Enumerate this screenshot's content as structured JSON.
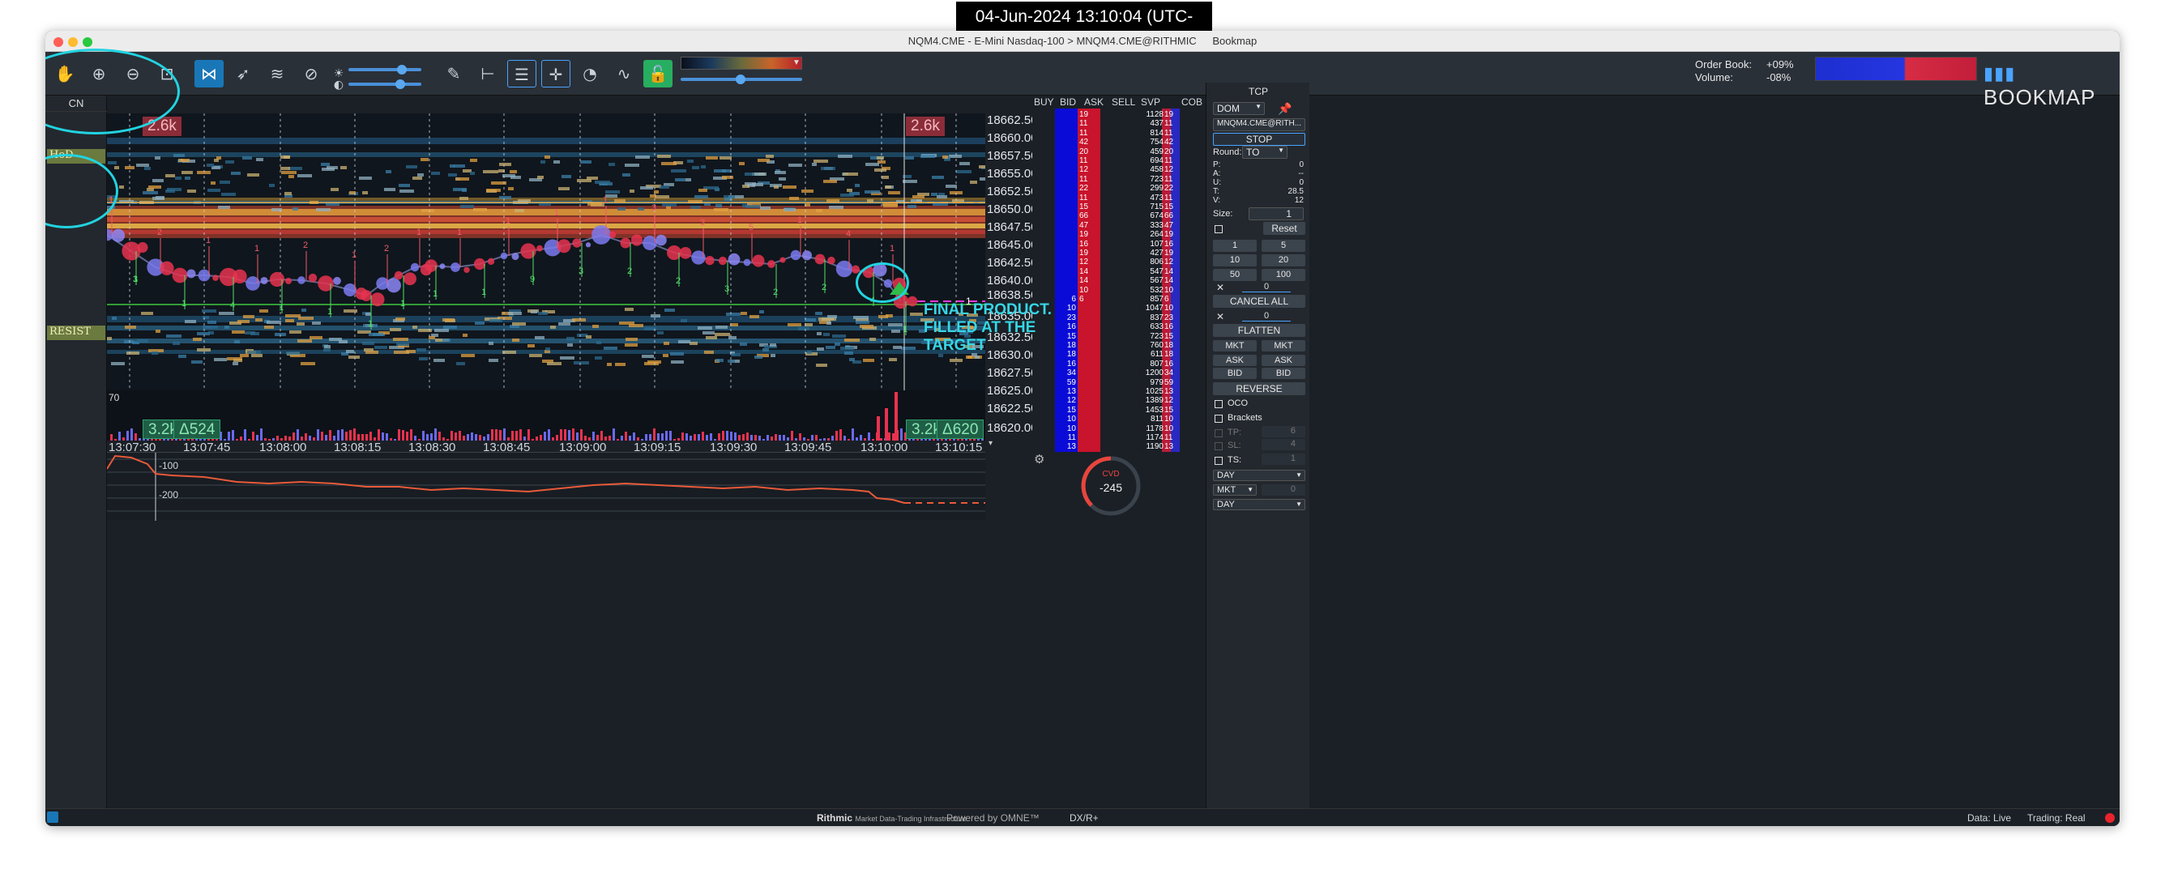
{
  "timestamp": "04-Jun-2024 13:10:04 (UTC-05:00)",
  "window": {
    "title": "NQM4.CME - E-Mini Nasdaq-100 > MNQM4.CME@RITHMIC",
    "app": "Bookmap"
  },
  "toolbar": {
    "icons": [
      "hand-icon",
      "zoom-in-icon",
      "zoom-out-icon",
      "zoom-fit-icon",
      "share-icon",
      "rocket-icon",
      "layers-icon",
      "link-icon",
      "brightness-icon",
      "contrast-icon",
      "pencil-icon",
      "measure-icon",
      "chat-icon",
      "crosshair-icon",
      "stopwatch-icon",
      "indicator-icon",
      "lock-open-icon"
    ]
  },
  "header_info": {
    "order_book_label": "Order Book:",
    "volume_label": "Volume:",
    "order_book_value": "+09%",
    "volume_value": "-08%",
    "logo": "BOOKMAP"
  },
  "sidebar": {
    "header": "CN",
    "labels": [
      "HoD",
      "RESIST"
    ]
  },
  "chart": {
    "top_left_tag": "2.6k",
    "top_right_tag": "2.6k",
    "vol_left": "3.2k",
    "delta_left": "Δ524",
    "vol_right": "3.2k",
    "delta_right": "Δ620",
    "vol_scale": "70",
    "annotation": "FINAL PRODUCT.  FILLED AT THE TARGET",
    "trade_numbers": [
      "1",
      "3",
      "2",
      "1",
      "1",
      "4",
      "1",
      "1",
      "2",
      "1",
      "1",
      "1",
      "2",
      "1",
      "1",
      "1",
      "1",
      "1",
      "1",
      "9",
      "1",
      "3",
      "1",
      "2",
      "3",
      "2",
      "3",
      "3",
      "5",
      "2",
      "1",
      "2",
      "4",
      "4",
      "1",
      "1",
      "1",
      "1"
    ],
    "time_ticks": [
      "13:07:30",
      "13:07:45",
      "13:08:00",
      "13:08:15",
      "13:08:30",
      "13:08:45",
      "13:09:00",
      "13:09:15",
      "13:09:30",
      "13:09:45",
      "13:10:00",
      "13:10:15"
    ],
    "price_ticks": [
      "18662.50",
      "18660.00",
      "18657.50",
      "18655.00",
      "18652.50",
      "18650.00",
      "18647.50",
      "18645.00",
      "18642.50",
      "18640.00",
      "18638.50",
      "18635.00",
      "18632.50",
      "18630.00",
      "18627.50",
      "18625.00",
      "18622.50",
      "18620.00"
    ],
    "order_marker": "1"
  },
  "cvd": {
    "levels": [
      "-100",
      "-200"
    ],
    "gauge_label": "CVD",
    "gauge_value": "-245"
  },
  "ladder": {
    "headers": [
      "BUY",
      "BID",
      "ASK",
      "SELL",
      "SVP",
      "COB"
    ],
    "rows": [
      {
        "ask": "19",
        "svp": "1128",
        "cob": "19"
      },
      {
        "ask": "11",
        "svp": "437",
        "cob": "11"
      },
      {
        "ask": "11",
        "svp": "814",
        "cob": "11"
      },
      {
        "ask": "42",
        "svp": "754",
        "cob": "42"
      },
      {
        "ask": "20",
        "svp": "459",
        "cob": "20"
      },
      {
        "ask": "11",
        "svp": "694",
        "cob": "11"
      },
      {
        "ask": "12",
        "svp": "458",
        "cob": "12"
      },
      {
        "ask": "11",
        "svp": "723",
        "cob": "11"
      },
      {
        "ask": "22",
        "svp": "299",
        "cob": "22"
      },
      {
        "ask": "11",
        "svp": "473",
        "cob": "11"
      },
      {
        "ask": "15",
        "svp": "715",
        "cob": "15"
      },
      {
        "ask": "66",
        "svp": "674",
        "cob": "66"
      },
      {
        "ask": "47",
        "svp": "333",
        "cob": "47"
      },
      {
        "ask": "19",
        "svp": "264",
        "cob": "19"
      },
      {
        "ask": "16",
        "svp": "107",
        "cob": "16"
      },
      {
        "ask": "19",
        "svp": "427",
        "cob": "19"
      },
      {
        "ask": "12",
        "svp": "806",
        "cob": "12"
      },
      {
        "ask": "14",
        "svp": "547",
        "cob": "14"
      },
      {
        "ask": "14",
        "svp": "567",
        "cob": "14"
      },
      {
        "ask": "10",
        "svp": "532",
        "cob": "10"
      },
      {
        "bid": "6",
        "ask": "6",
        "svp": "857",
        "cob": "6"
      },
      {
        "bid": "10",
        "svp": "1047",
        "cob": "10"
      },
      {
        "bid": "23",
        "svp": "837",
        "cob": "23"
      },
      {
        "bid": "16",
        "svp": "633",
        "cob": "16"
      },
      {
        "bid": "15",
        "svp": "723",
        "cob": "15"
      },
      {
        "bid": "18",
        "svp": "760",
        "cob": "18"
      },
      {
        "bid": "18",
        "svp": "611",
        "cob": "18"
      },
      {
        "bid": "16",
        "svp": "807",
        "cob": "16"
      },
      {
        "bid": "34",
        "svp": "1200",
        "cob": "34"
      },
      {
        "bid": "59",
        "svp": "979",
        "cob": "59"
      },
      {
        "bid": "13",
        "svp": "1025",
        "cob": "13"
      },
      {
        "bid": "12",
        "svp": "1389",
        "cob": "12"
      },
      {
        "bid": "15",
        "svp": "1453",
        "cob": "15"
      },
      {
        "bid": "10",
        "svp": "811",
        "cob": "10"
      },
      {
        "bid": "10",
        "svp": "1178",
        "cob": "10"
      },
      {
        "bid": "11",
        "svp": "1174",
        "cob": "11"
      },
      {
        "bid": "13",
        "svp": "1190",
        "cob": "13"
      }
    ]
  },
  "tcp": {
    "title": "TCP",
    "dom": "DOM",
    "instrument": "MNQM4.CME@RITH...",
    "stop": "STOP",
    "round_label": "Round:",
    "round_value": "TO",
    "stats": [
      {
        "k": "P:",
        "v": "0"
      },
      {
        "k": "A:",
        "v": "--"
      },
      {
        "k": "U:",
        "v": "0"
      },
      {
        "k": "T:",
        "v": "28.5"
      },
      {
        "k": "V:",
        "v": "12"
      }
    ],
    "size_label": "Size:",
    "size_value": "1",
    "reset": "Reset",
    "qty": [
      "1",
      "5",
      "10",
      "20",
      "50",
      "100"
    ],
    "cancel_count": "0",
    "cancel_all": "CANCEL ALL",
    "flatten_count": "0",
    "flatten": "FLATTEN",
    "mkt": "MKT",
    "ask": "ASK",
    "bid": "BID",
    "reverse": "REVERSE",
    "oco": "OCO",
    "brackets": "Brackets",
    "tp_label": "TP:",
    "tp_value": "6",
    "sl_label": "SL:",
    "sl_value": "4",
    "ts_label": "TS:",
    "ts_value": "1",
    "day1": "DAY",
    "order_type": "MKT",
    "order_qty": "0",
    "day2": "DAY"
  },
  "status": {
    "rithmic": "Rithmic",
    "rithmic_sub": "Market Data-Trading Infrastructure",
    "omne": "Powered by OMNE™",
    "dx": "DX/R+",
    "data": "Data: Live",
    "trading": "Trading: Real"
  }
}
